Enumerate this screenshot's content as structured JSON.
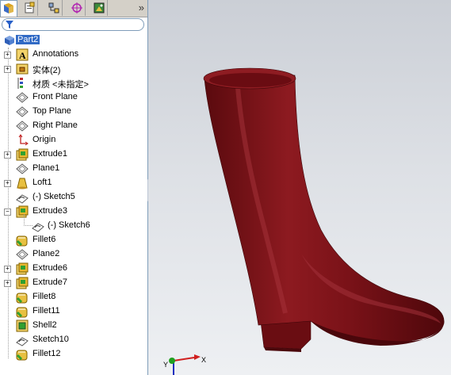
{
  "tabs": [
    "feature-manager-icon",
    "property-manager-icon",
    "configuration-manager-icon",
    "dimxpert-icon",
    "display-manager-icon"
  ],
  "more_symbol": "»",
  "tree": {
    "root": "Part2",
    "items": [
      {
        "label": "Annotations",
        "icon": "annotations-icon",
        "expandable": true
      },
      {
        "label": "实体(2)",
        "icon": "solid-bodies-icon",
        "expandable": true
      },
      {
        "label": "材质 <未指定>",
        "icon": "material-icon",
        "expandable": false
      },
      {
        "label": "Front Plane",
        "icon": "plane-icon",
        "expandable": false
      },
      {
        "label": "Top Plane",
        "icon": "plane-icon",
        "expandable": false
      },
      {
        "label": "Right Plane",
        "icon": "plane-icon",
        "expandable": false
      },
      {
        "label": "Origin",
        "icon": "origin-icon",
        "expandable": false
      },
      {
        "label": "Extrude1",
        "icon": "extrude-icon",
        "expandable": true
      },
      {
        "label": "Plane1",
        "icon": "plane-icon",
        "expandable": false
      },
      {
        "label": "Loft1",
        "icon": "loft-icon",
        "expandable": true
      },
      {
        "label": "(-) Sketch5",
        "icon": "sketch-icon",
        "expandable": false
      },
      {
        "label": "Extrude3",
        "icon": "extrude-icon",
        "expandable": true,
        "expanded": true
      },
      {
        "label": "(-) Sketch6",
        "icon": "sketch-icon",
        "expandable": false,
        "child": true
      },
      {
        "label": "Fillet6",
        "icon": "fillet-icon",
        "expandable": false
      },
      {
        "label": "Plane2",
        "icon": "plane-icon",
        "expandable": false
      },
      {
        "label": "Extrude6",
        "icon": "extrude-icon",
        "expandable": true
      },
      {
        "label": "Extrude7",
        "icon": "extrude-icon",
        "expandable": true
      },
      {
        "label": "Fillet8",
        "icon": "fillet-icon",
        "expandable": false
      },
      {
        "label": "Fillet11",
        "icon": "fillet-icon",
        "expandable": false
      },
      {
        "label": "Shell2",
        "icon": "shell-icon",
        "expandable": false
      },
      {
        "label": "Sketch10",
        "icon": "sketch-icon",
        "expandable": false
      },
      {
        "label": "Fillet12",
        "icon": "fillet-icon",
        "expandable": false
      }
    ]
  },
  "triad": {
    "y": "Y",
    "x": "X"
  },
  "colors": {
    "model": "#7a1016",
    "selection": "#316ac5"
  }
}
